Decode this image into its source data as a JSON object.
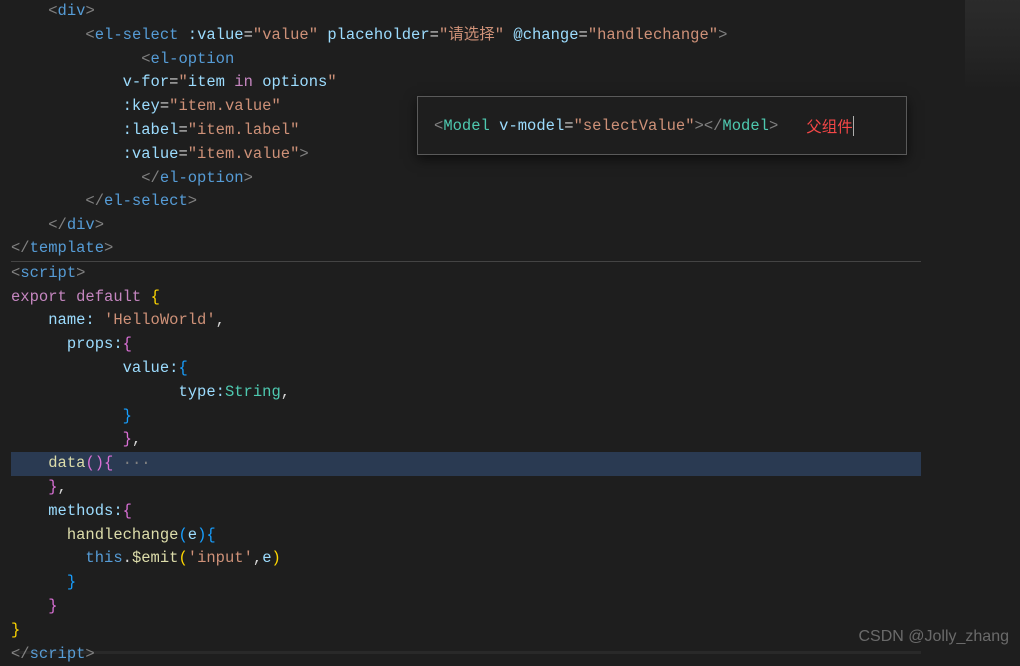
{
  "code": {
    "lines": [
      {
        "indent": 2,
        "tokens": [
          {
            "t": "<",
            "c": "gray"
          },
          {
            "t": "div",
            "c": "blue"
          },
          {
            "t": ">",
            "c": "gray"
          }
        ]
      },
      {
        "indent": 4,
        "tokens": [
          {
            "t": "<",
            "c": "gray"
          },
          {
            "t": "el-select",
            "c": "blue"
          },
          {
            "t": " ",
            "c": "white"
          },
          {
            "t": ":value",
            "c": "lblue"
          },
          {
            "t": "=",
            "c": "white"
          },
          {
            "t": "\"value\"",
            "c": "orange"
          },
          {
            "t": " ",
            "c": "white"
          },
          {
            "t": "placeholder",
            "c": "lblue"
          },
          {
            "t": "=",
            "c": "white"
          },
          {
            "t": "\"请选择\"",
            "c": "orange"
          },
          {
            "t": " ",
            "c": "white"
          },
          {
            "t": "@change",
            "c": "lblue"
          },
          {
            "t": "=",
            "c": "white"
          },
          {
            "t": "\"handlechange\"",
            "c": "orange"
          },
          {
            "t": ">",
            "c": "gray"
          }
        ]
      },
      {
        "indent": 7,
        "tokens": [
          {
            "t": "<",
            "c": "gray"
          },
          {
            "t": "el-option",
            "c": "blue"
          }
        ]
      },
      {
        "indent": 6,
        "tokens": [
          {
            "t": "v-for",
            "c": "lblue"
          },
          {
            "t": "=",
            "c": "white"
          },
          {
            "t": "\"",
            "c": "orange"
          },
          {
            "t": "item ",
            "c": "lblue"
          },
          {
            "t": "in",
            "c": "purple"
          },
          {
            "t": " options",
            "c": "lblue"
          },
          {
            "t": "\"",
            "c": "orange"
          }
        ]
      },
      {
        "indent": 6,
        "tokens": [
          {
            "t": ":key",
            "c": "lblue"
          },
          {
            "t": "=",
            "c": "white"
          },
          {
            "t": "\"item.value\"",
            "c": "orange"
          }
        ]
      },
      {
        "indent": 6,
        "tokens": [
          {
            "t": ":label",
            "c": "lblue"
          },
          {
            "t": "=",
            "c": "white"
          },
          {
            "t": "\"item.label\"",
            "c": "orange"
          }
        ]
      },
      {
        "indent": 6,
        "tokens": [
          {
            "t": ":value",
            "c": "lblue"
          },
          {
            "t": "=",
            "c": "white"
          },
          {
            "t": "\"item.value\"",
            "c": "orange"
          },
          {
            "t": ">",
            "c": "gray"
          }
        ]
      },
      {
        "indent": 7,
        "tokens": [
          {
            "t": "</",
            "c": "gray"
          },
          {
            "t": "el-option",
            "c": "blue"
          },
          {
            "t": ">",
            "c": "gray"
          }
        ]
      },
      {
        "indent": 4,
        "tokens": [
          {
            "t": "</",
            "c": "gray"
          },
          {
            "t": "el-select",
            "c": "blue"
          },
          {
            "t": ">",
            "c": "gray"
          }
        ]
      },
      {
        "indent": 2,
        "tokens": [
          {
            "t": "</",
            "c": "gray"
          },
          {
            "t": "div",
            "c": "blue"
          },
          {
            "t": ">",
            "c": "gray"
          }
        ]
      },
      {
        "indent": 0,
        "tokens": [
          {
            "t": "</",
            "c": "gray"
          },
          {
            "t": "template",
            "c": "blue"
          },
          {
            "t": ">",
            "c": "gray"
          }
        ],
        "border": true
      },
      {
        "indent": 0,
        "tokens": [
          {
            "t": "<",
            "c": "gray"
          },
          {
            "t": "script",
            "c": "blue"
          },
          {
            "t": ">",
            "c": "gray"
          }
        ]
      },
      {
        "indent": 0,
        "tokens": [
          {
            "t": "export",
            "c": "purple"
          },
          {
            "t": " ",
            "c": "white"
          },
          {
            "t": "default",
            "c": "purple"
          },
          {
            "t": " ",
            "c": "white"
          },
          {
            "t": "{",
            "c": "brace"
          }
        ]
      },
      {
        "indent": 2,
        "tokens": [
          {
            "t": "name:",
            "c": "lblue"
          },
          {
            "t": " ",
            "c": "white"
          },
          {
            "t": "'HelloWorld'",
            "c": "orange"
          },
          {
            "t": ",",
            "c": "white"
          }
        ]
      },
      {
        "indent": 3,
        "tokens": [
          {
            "t": "props:",
            "c": "lblue"
          },
          {
            "t": "{",
            "c": "brace2"
          }
        ]
      },
      {
        "indent": 6,
        "tokens": [
          {
            "t": "value:",
            "c": "lblue"
          },
          {
            "t": "{",
            "c": "brace3"
          }
        ]
      },
      {
        "indent": 9,
        "tokens": [
          {
            "t": "type:",
            "c": "lblue"
          },
          {
            "t": "String",
            "c": "teal"
          },
          {
            "t": ",",
            "c": "white"
          }
        ]
      },
      {
        "indent": 6,
        "tokens": [
          {
            "t": "}",
            "c": "brace3"
          }
        ]
      },
      {
        "indent": 6,
        "tokens": [
          {
            "t": "}",
            "c": "brace2"
          },
          {
            "t": ",",
            "c": "white"
          }
        ]
      },
      {
        "indent": 2,
        "tokens": [
          {
            "t": "data",
            "c": "yellow"
          },
          {
            "t": "()",
            "c": "brace2"
          },
          {
            "t": "{",
            "c": "brace2"
          },
          {
            "t": " ···",
            "c": "gray"
          }
        ],
        "highlight": true
      },
      {
        "indent": 2,
        "tokens": [
          {
            "t": "}",
            "c": "brace2"
          },
          {
            "t": ",",
            "c": "white"
          }
        ]
      },
      {
        "indent": 2,
        "tokens": [
          {
            "t": "methods:",
            "c": "lblue"
          },
          {
            "t": "{",
            "c": "brace2"
          }
        ]
      },
      {
        "indent": 3,
        "tokens": [
          {
            "t": "handlechange",
            "c": "yellow"
          },
          {
            "t": "(",
            "c": "brace3"
          },
          {
            "t": "e",
            "c": "lblue"
          },
          {
            "t": ")",
            "c": "brace3"
          },
          {
            "t": "{",
            "c": "brace3"
          }
        ]
      },
      {
        "indent": 4,
        "tokens": [
          {
            "t": "this",
            "c": "blue"
          },
          {
            "t": ".",
            "c": "white"
          },
          {
            "t": "$emit",
            "c": "yellow"
          },
          {
            "t": "(",
            "c": "brace"
          },
          {
            "t": "'input'",
            "c": "orange"
          },
          {
            "t": ",",
            "c": "white"
          },
          {
            "t": "e",
            "c": "lblue"
          },
          {
            "t": ")",
            "c": "brace"
          }
        ]
      },
      {
        "indent": 3,
        "tokens": [
          {
            "t": "}",
            "c": "brace3"
          }
        ]
      },
      {
        "indent": 2,
        "tokens": [
          {
            "t": "}",
            "c": "brace2"
          }
        ]
      },
      {
        "indent": 0,
        "tokens": [
          {
            "t": "}",
            "c": "brace"
          }
        ]
      },
      {
        "indent": 0,
        "tokens": [
          {
            "t": "</",
            "c": "gray"
          },
          {
            "t": "script",
            "c": "blue"
          },
          {
            "t": ">",
            "c": "gray"
          }
        ]
      }
    ]
  },
  "popup": {
    "tokens": [
      {
        "t": "<",
        "c": "gray"
      },
      {
        "t": "Model",
        "c": "teal"
      },
      {
        "t": " ",
        "c": "white"
      },
      {
        "t": "v-model",
        "c": "lblue"
      },
      {
        "t": "=",
        "c": "white"
      },
      {
        "t": "\"selectValue\"",
        "c": "orange"
      },
      {
        "t": ">",
        "c": "gray"
      },
      {
        "t": "</",
        "c": "gray"
      },
      {
        "t": "Model",
        "c": "teal"
      },
      {
        "t": ">",
        "c": "gray"
      }
    ],
    "comment": "父组件"
  },
  "watermark": "CSDN @Jolly_zhang"
}
